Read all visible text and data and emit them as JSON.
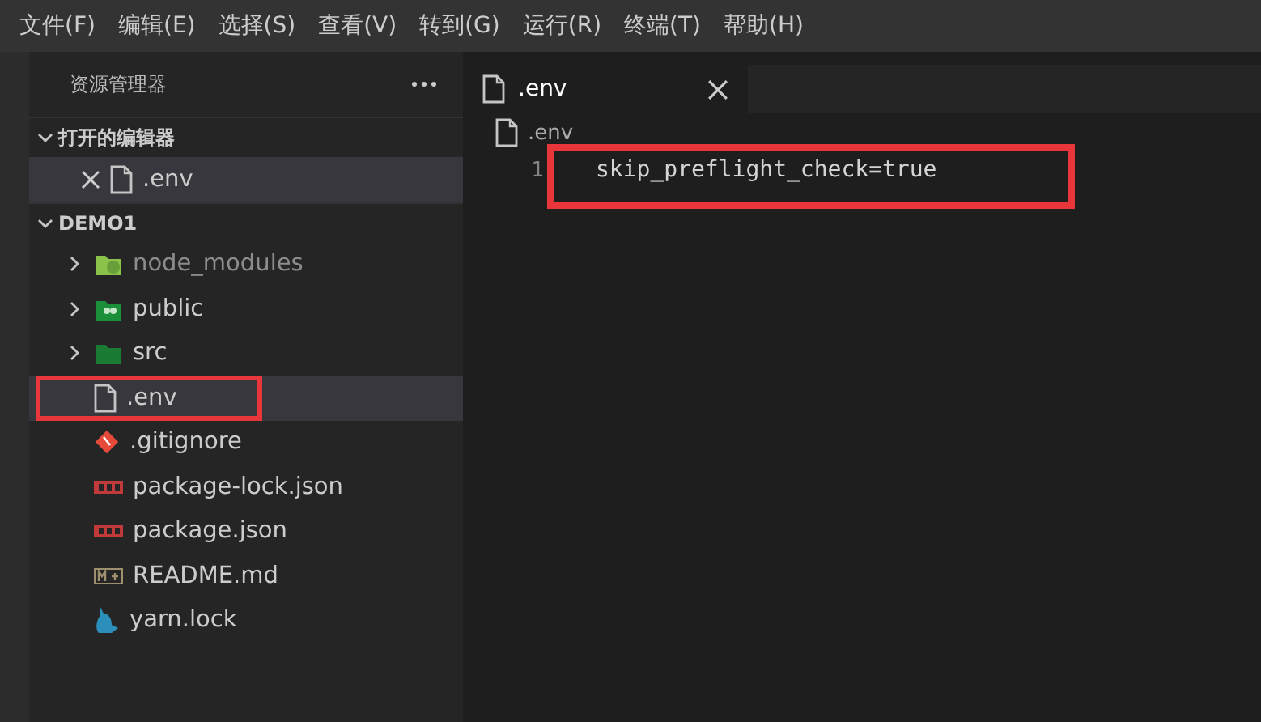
{
  "menu": [
    {
      "label": "文件(F)"
    },
    {
      "label": "编辑(E)"
    },
    {
      "label": "选择(S)"
    },
    {
      "label": "查看(V)"
    },
    {
      "label": "转到(G)"
    },
    {
      "label": "运行(R)"
    },
    {
      "label": "终端(T)"
    },
    {
      "label": "帮助(H)"
    }
  ],
  "explorer": {
    "title": "资源管理器"
  },
  "open_editors": {
    "title": "打开的编辑器",
    "expanded": true,
    "items": [
      {
        "name": ".env",
        "selected": true
      }
    ]
  },
  "project": {
    "title": "DEMO1",
    "expanded": true,
    "children": [
      {
        "name": "node_modules",
        "kind": "folder",
        "expanded": false,
        "dimmed": true,
        "selected": false,
        "highlighted": false
      },
      {
        "name": "public",
        "kind": "folder",
        "expanded": false,
        "dimmed": false,
        "selected": false,
        "highlighted": false
      },
      {
        "name": "src",
        "kind": "folder",
        "expanded": false,
        "dimmed": false,
        "selected": false,
        "highlighted": false
      },
      {
        "name": ".env",
        "kind": "file",
        "dimmed": false,
        "selected": true,
        "highlighted": true
      },
      {
        "name": ".gitignore",
        "kind": "file",
        "dimmed": false,
        "selected": false,
        "highlighted": false
      },
      {
        "name": "package-lock.json",
        "kind": "file",
        "dimmed": false,
        "selected": false,
        "highlighted": false
      },
      {
        "name": "package.json",
        "kind": "file",
        "dimmed": false,
        "selected": false,
        "highlighted": false
      },
      {
        "name": "README.md",
        "kind": "file",
        "dimmed": false,
        "selected": false,
        "highlighted": false
      },
      {
        "name": "yarn.lock",
        "kind": "file",
        "dimmed": false,
        "selected": false,
        "highlighted": false
      }
    ]
  },
  "editor": {
    "tabs": [
      {
        "name": ".env",
        "selected": true
      }
    ],
    "breadcrumb": [
      ".env"
    ],
    "lines": [
      {
        "number": "1",
        "text": "skip_preflight_check=true"
      }
    ],
    "highlighted": true
  }
}
